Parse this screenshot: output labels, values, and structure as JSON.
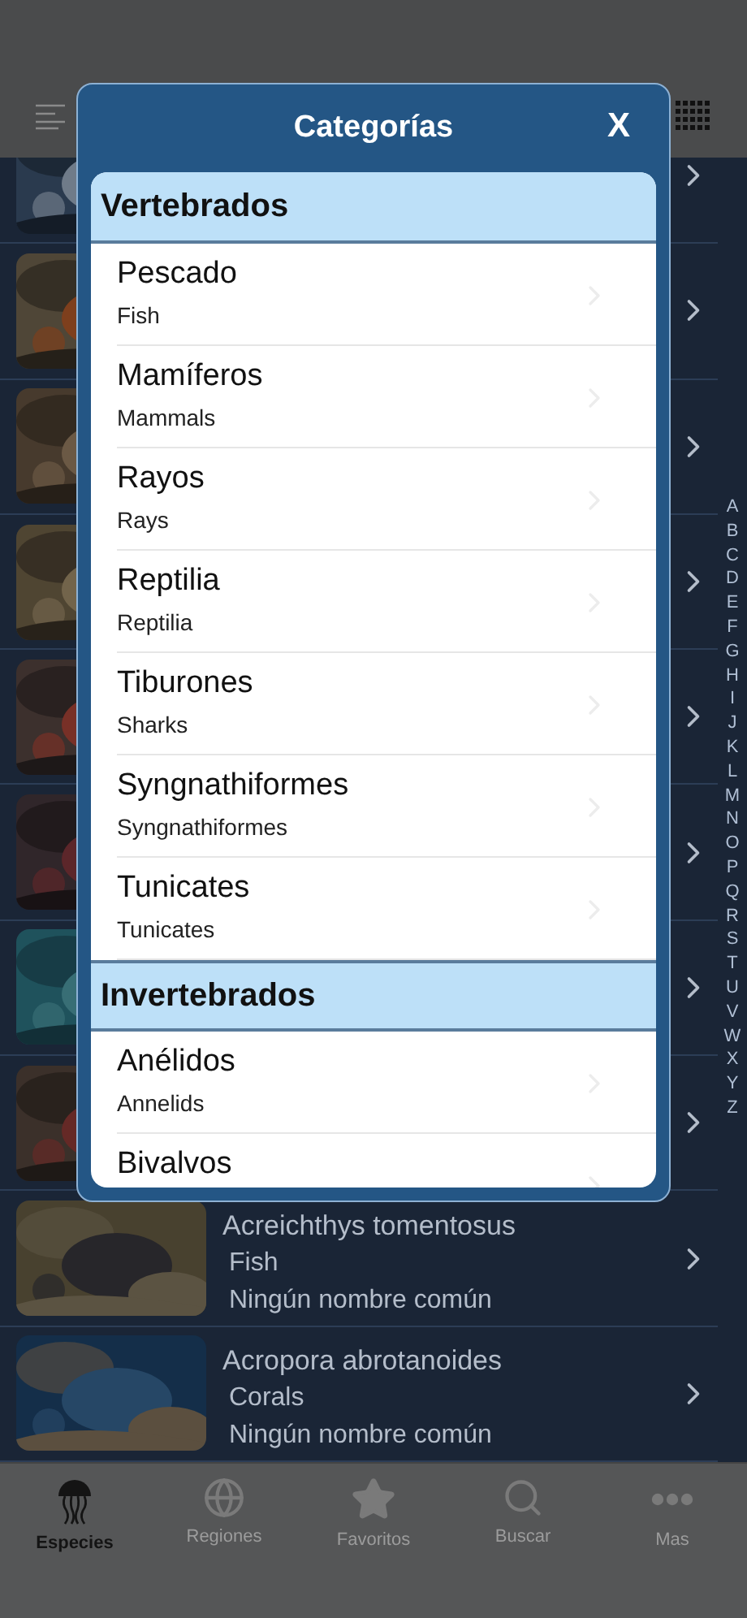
{
  "rows": [
    {
      "kind": "covered"
    },
    {
      "kind": "covered"
    },
    {
      "kind": "covered"
    },
    {
      "kind": "covered"
    },
    {
      "kind": "covered"
    },
    {
      "kind": "covered"
    },
    {
      "kind": "covered"
    },
    {
      "kind": "covered"
    },
    {
      "kind": "entry",
      "name": "Acreichthys tomentosus",
      "category": "Fish",
      "common_name": "Ningún nombre común"
    },
    {
      "kind": "entry",
      "name": "Acropora abrotanoides",
      "category": "Corals",
      "common_name": "Ningún nombre común"
    }
  ],
  "index_letters": [
    "A",
    "B",
    "C",
    "D",
    "E",
    "F",
    "G",
    "H",
    "I",
    "J",
    "K",
    "L",
    "M",
    "N",
    "O",
    "P",
    "Q",
    "R",
    "S",
    "T",
    "U",
    "V",
    "W",
    "X",
    "Y",
    "Z"
  ],
  "modal": {
    "title": "Categorías",
    "close": "X",
    "sections": [
      {
        "title": "Vertebrados",
        "items": [
          {
            "name": "Pescado",
            "subtitle": "Fish"
          },
          {
            "name": "Mamíferos",
            "subtitle": "Mammals"
          },
          {
            "name": "Rayos",
            "subtitle": "Rays"
          },
          {
            "name": "Reptilia",
            "subtitle": "Reptilia"
          },
          {
            "name": "Tiburones",
            "subtitle": "Sharks"
          },
          {
            "name": "Syngnathiformes",
            "subtitle": "Syngnathiformes"
          },
          {
            "name": "Tunicates",
            "subtitle": "Tunicates"
          }
        ]
      },
      {
        "title": "Invertebrados",
        "items": [
          {
            "name": "Anélidos",
            "subtitle": "Annelids"
          },
          {
            "name": "Bivalvos"
          }
        ]
      }
    ]
  },
  "tabs": [
    {
      "label": "Especies",
      "selected": true
    },
    {
      "label": "Regiones",
      "selected": false
    },
    {
      "label": "Favoritos",
      "selected": false
    },
    {
      "label": "Buscar",
      "selected": false
    },
    {
      "label": "Mas",
      "selected": false
    }
  ]
}
